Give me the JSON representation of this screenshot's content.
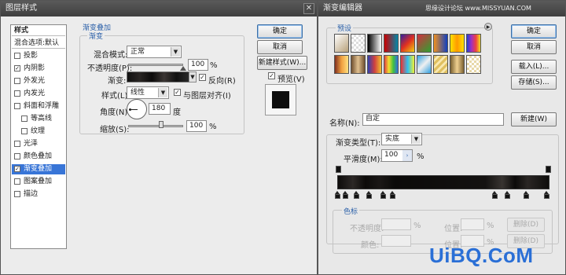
{
  "layer_style": {
    "title": "图层样式",
    "close": "✕",
    "styles_header": "样式",
    "blend_options": "混合选项:默认",
    "styles": [
      {
        "label": "投影",
        "checked": false
      },
      {
        "label": "内阴影",
        "checked": true
      },
      {
        "label": "外发光",
        "checked": false
      },
      {
        "label": "内发光",
        "checked": false
      },
      {
        "label": "斜面和浮雕",
        "checked": false
      },
      {
        "label": "等高线",
        "checked": false
      },
      {
        "label": "纹理",
        "checked": false
      },
      {
        "label": "光泽",
        "checked": false
      },
      {
        "label": "颜色叠加",
        "checked": false
      },
      {
        "label": "渐变叠加",
        "checked": true,
        "selected": true
      },
      {
        "label": "图案叠加",
        "checked": false
      },
      {
        "label": "描边",
        "checked": false
      }
    ],
    "section_title": "渐变叠加",
    "group_title": "渐变",
    "blend_mode_label": "混合模式:",
    "blend_mode_value": "正常",
    "opacity_label": "不透明度(P):",
    "opacity_value": "100",
    "percent": "%",
    "gradient_label": "渐变:",
    "reverse_label": "反向(R)",
    "reverse_checked": true,
    "style_label": "样式(L):",
    "style_value": "线性",
    "align_label": "与图层对齐(I)",
    "align_checked": true,
    "angle_label": "角度(N):",
    "angle_value": "180",
    "angle_unit": "度",
    "scale_label": "缩放(S):",
    "scale_value": "100",
    "ok": "确定",
    "cancel": "取消",
    "new_style": "新建样式(W)...",
    "preview_label": "预览(V)",
    "preview_checked": true
  },
  "gradient_editor": {
    "title": "渐变编辑器",
    "watermark_top": "思缘设计论坛 www.MISSYUAN.COM",
    "presets_label": "预设",
    "ok": "确定",
    "cancel": "取消",
    "load": "载入(L)...",
    "save": "存储(S)...",
    "name_label": "名称(N):",
    "name_value": "自定",
    "new_button": "新建(W)",
    "type_label": "渐变类型(T):",
    "type_value": "实底",
    "smooth_label": "平滑度(M):",
    "smooth_value": "100",
    "percent": "%",
    "stops_group": "色标",
    "stop_opacity_label": "不透明度:",
    "stop_location_label": "位置:",
    "stop_color_label": "颜色:",
    "delete_label": "删除(D)"
  },
  "watermark": "UiBQ.CoM",
  "colors": {
    "selection": "#3875d7",
    "accent_text": "#2a5fa8",
    "watermark": "#2a6fd6"
  }
}
